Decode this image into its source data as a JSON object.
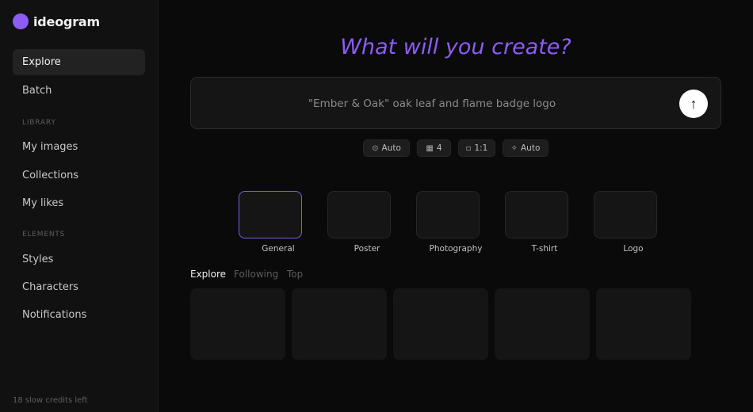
{
  "brand": {
    "name": "ideogram",
    "accent": "#8b5cf6"
  },
  "sidebar": {
    "items": [
      {
        "label": "Explore",
        "active": true
      },
      {
        "label": "Batch"
      },
      {
        "label": "My images"
      },
      {
        "label": "Collections"
      },
      {
        "label": "My likes"
      },
      {
        "label": "Styles"
      },
      {
        "label": "Characters"
      },
      {
        "label": "Notifications"
      }
    ],
    "sections": {
      "library": "LIBRARY",
      "elements": "ELEMENTS"
    },
    "credits": "18 slow credits left"
  },
  "main": {
    "headline": "What will you create?",
    "prompt": {
      "text": "\"Ember & Oak\" oak leaf and flame badge logo",
      "submit_icon": "arrow-up-icon"
    },
    "options": [
      {
        "icon": "⊙",
        "icon_name": "magic-prompt-icon",
        "label": "Auto"
      },
      {
        "icon": "▦",
        "icon_name": "image-count-icon",
        "label": "4"
      },
      {
        "icon": "▫",
        "icon_name": "aspect-ratio-icon",
        "label": "1:1"
      },
      {
        "icon": "✧",
        "icon_name": "sparkle-icon",
        "label": "Auto"
      }
    ],
    "styles": [
      "General",
      "Poster",
      "Photography",
      "T-shirt",
      "Logo"
    ],
    "selected_style": "General",
    "tabs": [
      {
        "label": "Explore",
        "active": true
      },
      {
        "label": "Following"
      },
      {
        "label": "Top"
      }
    ]
  }
}
